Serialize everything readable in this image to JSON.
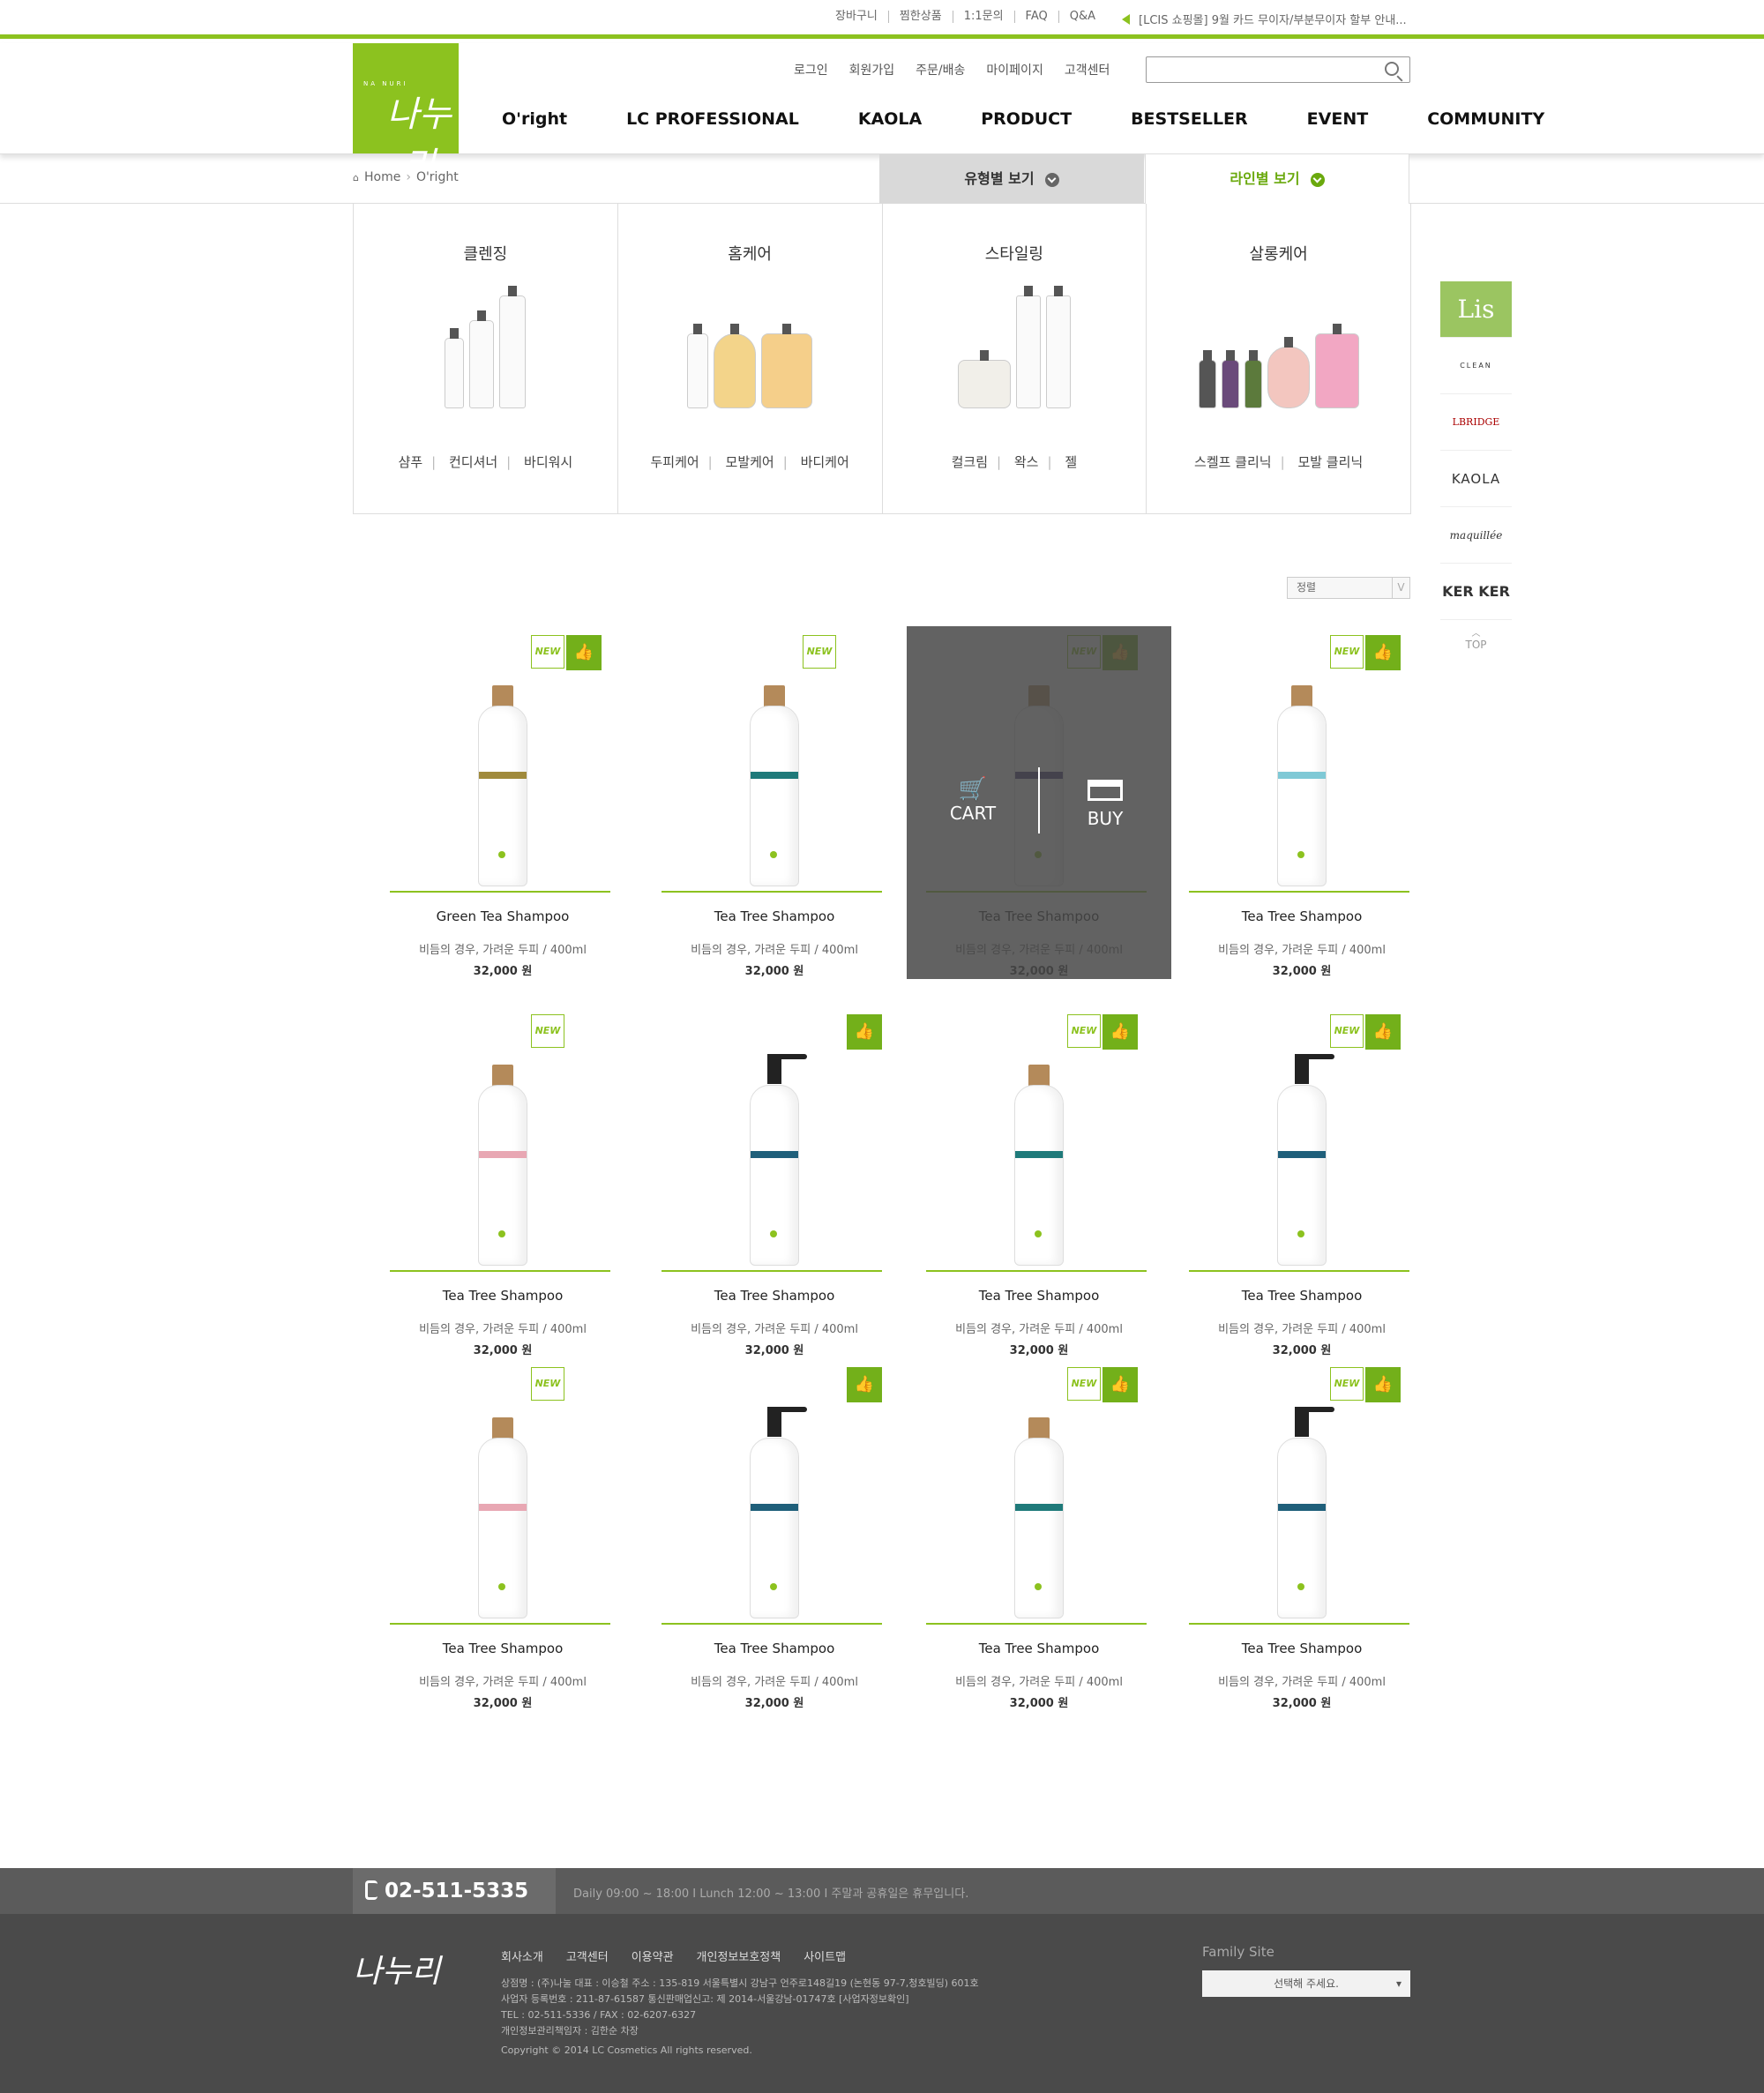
{
  "util_nav": [
    "장바구니",
    "찜한상품",
    "1:1문의",
    "FAQ",
    "Q&A"
  ],
  "notice": "[LCIS 쇼핑몰] 9월 카드 무이자/부분무이자 할부 안내...",
  "logo": {
    "en": "NA NURI",
    "kr": "나누리"
  },
  "member_nav": [
    "로그인",
    "회원가입",
    "주문/배송",
    "마이페이지",
    "고객센터"
  ],
  "gnb": [
    "O'right",
    "LC PROFESSIONAL",
    "KAOLA",
    "PRODUCT",
    "BESTSELLER",
    "EVENT",
    "COMMUNITY"
  ],
  "breadcrumb": {
    "home": "Home",
    "current": "O'right"
  },
  "tabs": {
    "type": "유형별 보기",
    "line": "라인별 보기"
  },
  "categories": [
    {
      "title": "클렌징",
      "links": [
        "샴푸",
        "컨디셔너",
        "바디워시"
      ]
    },
    {
      "title": "홈케어",
      "links": [
        "두피케어",
        "모발케어",
        "바디케어"
      ]
    },
    {
      "title": "스타일링",
      "links": [
        "컬크림",
        "왁스",
        "젤"
      ]
    },
    {
      "title": "살롱케어",
      "links": [
        "스켈프 클리닉",
        "모발 클리닉"
      ]
    }
  ],
  "sort": {
    "label": "정렬",
    "arrow": "V"
  },
  "side_brands": [
    "Lis",
    "CLEAN",
    "LBRIDGE",
    "KAOLA",
    "maquillée",
    "KER KER",
    "TOP"
  ],
  "hover": {
    "cart": "CART",
    "buy": "BUY"
  },
  "badge_new": "NEW",
  "products": [
    {
      "name": "Green Tea Shampoo",
      "desc": "비듬의 경우, 가려운 두피 / 400ml",
      "price": "32,000 원"
    },
    {
      "name": "Tea Tree Shampoo",
      "desc": "비듬의 경우, 가려운 두피 / 400ml",
      "price": "32,000 원"
    },
    {
      "name": "Tea Tree Shampoo",
      "desc": "비듬의 경우, 가려운 두피 / 400ml",
      "price": "32,000 원"
    },
    {
      "name": "Tea Tree Shampoo",
      "desc": "비듬의 경우, 가려운 두피 / 400ml",
      "price": "32,000 원"
    },
    {
      "name": "Tea Tree Shampoo",
      "desc": "비듬의 경우, 가려운 두피 / 400ml",
      "price": "32,000 원"
    },
    {
      "name": "Tea Tree Shampoo",
      "desc": "비듬의 경우, 가려운 두피 / 400ml",
      "price": "32,000 원"
    },
    {
      "name": "Tea Tree Shampoo",
      "desc": "비듬의 경우, 가려운 두피 / 400ml",
      "price": "32,000 원"
    },
    {
      "name": "Tea Tree Shampoo",
      "desc": "비듬의 경우, 가려운 두피 / 400ml",
      "price": "32,000 원"
    },
    {
      "name": "Tea Tree Shampoo",
      "desc": "비듬의 경우, 가려운 두피 / 400ml",
      "price": "32,000 원"
    },
    {
      "name": "Tea Tree Shampoo",
      "desc": "비듬의 경우, 가려운 두피 / 400ml",
      "price": "32,000 원"
    },
    {
      "name": "Tea Tree Shampoo",
      "desc": "비듬의 경우, 가려운 두피 / 400ml",
      "price": "32,000 원"
    },
    {
      "name": "Tea Tree Shampoo",
      "desc": "비듬의 경우, 가려운 두피 / 400ml",
      "price": "32,000 원"
    }
  ],
  "footer": {
    "tel": "02-511-5335",
    "hours": "Daily  09:00 ~ 18:00   I   Lunch  12:00 ~ 13:00   I   주말과 공휴일은 휴무입니다.",
    "links": [
      "회사소개",
      "고객센터",
      "이용약관",
      "개인정보보호정책",
      "사이트맵"
    ],
    "info": [
      "상점명 : (주)나눌 대표 : 이승철 주소 : 135-819 서울특별시 강남구 언주로148길19 (논현동 97-7,청호빌딩) 601호",
      "사업자 등록번호 : 211-87-61587 통신판매업신고: 제 2014-서울강남-01747호 [사업자정보확인]",
      "TEL : 02-511-5336 / FAX : 02-6207-6327",
      "개인정보관리책임자 : 김한순 차장",
      "Copyright © 2014 LC Cosmetics All rights reserved."
    ],
    "family_label": "Family Site",
    "family_select": "선택해 주세요."
  },
  "colors": {
    "accent": "#8cc21f",
    "like": "#73b01a",
    "footer": "#4a4a4a"
  }
}
